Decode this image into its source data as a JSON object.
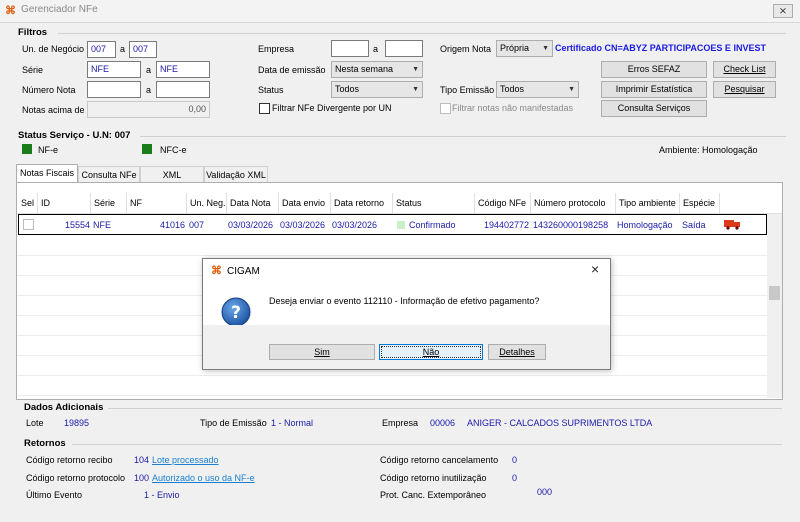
{
  "window": {
    "title": "Gerenciador NFe",
    "close_label": "⨯"
  },
  "filtros": {
    "title": "Filtros",
    "un_negocio": {
      "label": "Un. de Negócio",
      "from": "007",
      "sep": "a",
      "to": "007"
    },
    "serie": {
      "label": "Série",
      "from": "NFE",
      "sep": "a",
      "to": "NFE"
    },
    "numero_nota": {
      "label": "Número Nota",
      "from": "",
      "sep": "a",
      "to": ""
    },
    "notas_acima": {
      "label": "Notas acima de",
      "value": "0,00"
    },
    "empresa": {
      "label": "Empresa",
      "from": "",
      "sep": "a",
      "to": ""
    },
    "data_emissao": {
      "label": "Data de emissão",
      "value": "Nesta semana"
    },
    "status": {
      "label": "Status",
      "value": "Todos"
    },
    "filtrar_divergente": {
      "label": "Filtrar NFe Divergente por UN",
      "checked": false
    },
    "origem_nota": {
      "label": "Origem Nota",
      "value": "Própria"
    },
    "certificado": "Certificado CN=ABYZ PARTICIPACOES E INVEST",
    "tipo_emissao": {
      "label": "Tipo Emissão",
      "value": "Todos"
    },
    "filtrar_nao_manifestadas": {
      "label": "Filtrar notas não manifestadas",
      "checked": false
    },
    "buttons": {
      "erros_sefaz": "Erros SEFAZ",
      "check_list": "Check List",
      "imprimir_estatistica": "Imprimir Estatística",
      "pesquisar": "Pesquisar",
      "consulta_servicos": "Consulta Serviços"
    }
  },
  "status_servico": {
    "title": "Status Serviço - U.N: 007",
    "nfe_label": "NF-e",
    "nfce_label": "NFC-e",
    "ambiente": "Ambiente: Homologação",
    "indicator_color": "#1a7d1a"
  },
  "tabs": [
    "Notas Fiscais",
    "Consulta NFe",
    "XML",
    "Validação XML"
  ],
  "grid": {
    "headers": [
      "Sel",
      "ID",
      "Série",
      "NF",
      "Un. Neg.",
      "Data Nota",
      "Data envio",
      "Data retorno",
      "Status",
      "Código NFe",
      "Número protocolo",
      "Tipo ambiente",
      "Espécie"
    ],
    "rows": [
      {
        "id": "15554",
        "serie": "NFE",
        "nf": "41016",
        "un_neg": "007",
        "data_nota": "03/03/2026",
        "data_envio": "03/03/2026",
        "data_retorno": "03/03/2026",
        "status": "Confirmado",
        "codigo_nfe": "194402772",
        "numero_protocolo": "143260000198258",
        "tipo_ambiente": "Homologação",
        "especie": "Saída",
        "icon": "truck-icon"
      }
    ]
  },
  "dialog": {
    "title": "CIGAM",
    "message": "Deseja enviar o evento 112110 - Informação de efetivo pagamento?",
    "yes": "Sim",
    "no": "Não",
    "details": "Detalhes",
    "icon": "question-icon"
  },
  "dados_adicionais": {
    "title": "Dados Adicionais",
    "lote_label": "Lote",
    "lote_value": "19895",
    "tipo_emissao_label": "Tipo de Emissão",
    "tipo_emissao_value": "1 - Normal",
    "empresa_label": "Empresa",
    "empresa_code": "00006",
    "empresa_name": "ANIGER - CALCADOS SUPRIMENTOS LTDA"
  },
  "retornos": {
    "title": "Retornos",
    "recibo_label": "Código retorno recibo",
    "recibo_code": "104",
    "recibo_text": "Lote processado",
    "protocolo_label": "Código retorno protocolo",
    "protocolo_code": "100",
    "protocolo_text": "Autorizado o uso da NF-e",
    "ultimo_evento_label": "Último Evento",
    "ultimo_evento_value": "1 - Envio",
    "cancelamento_label": "Código retorno cancelamento",
    "cancelamento_value": "0",
    "inutilizacao_label": "Código retorno inutilização",
    "inutilizacao_value": "0",
    "prot_canc_label": "Prot. Canc. Extemporâneo",
    "prot_canc_value": "000"
  }
}
